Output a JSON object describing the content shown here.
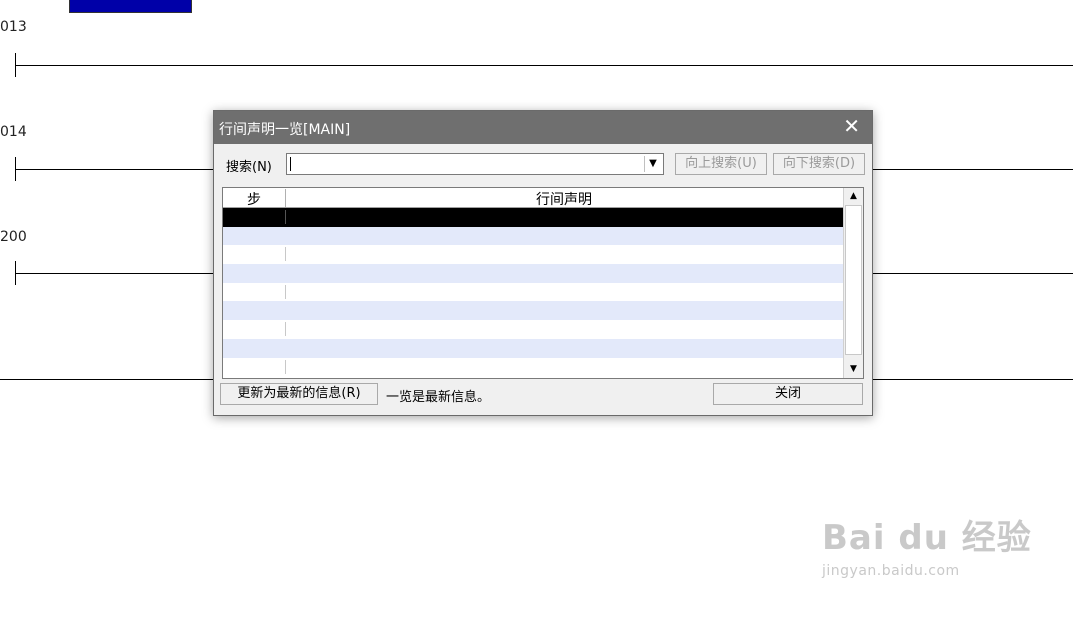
{
  "ladder": {
    "step_labels": [
      "013",
      "014",
      "200"
    ]
  },
  "dialog": {
    "title": "行间声明一览[MAIN]",
    "close_glyph": "✕",
    "search": {
      "label": "搜索(N)",
      "value": "",
      "dropdown_glyph": "▼"
    },
    "buttons": {
      "search_up": "向上搜索(U)",
      "search_down": "向下搜索(D)",
      "refresh": "更新为最新的信息(R)",
      "close": "关闭"
    },
    "list": {
      "columns": [
        "步",
        "行间声明"
      ],
      "rows": [
        {
          "step": "",
          "comment": "",
          "selected": true
        },
        {
          "step": "",
          "comment": ""
        },
        {
          "step": "",
          "comment": ""
        },
        {
          "step": "",
          "comment": ""
        },
        {
          "step": "",
          "comment": ""
        },
        {
          "step": "",
          "comment": ""
        },
        {
          "step": "",
          "comment": ""
        },
        {
          "step": "",
          "comment": ""
        },
        {
          "step": "",
          "comment": ""
        }
      ],
      "scroll_up_glyph": "▲",
      "scroll_down_glyph": "▼"
    },
    "status": "一览是最新信息。"
  },
  "watermark": {
    "brand": "Bai du 经验",
    "url": "jingyan.baidu.com"
  },
  "colors": {
    "titlebar": "#6f6f6f",
    "selected_row": "#000000",
    "alt_row": "#e3e9fa",
    "block": "#0000a8"
  }
}
